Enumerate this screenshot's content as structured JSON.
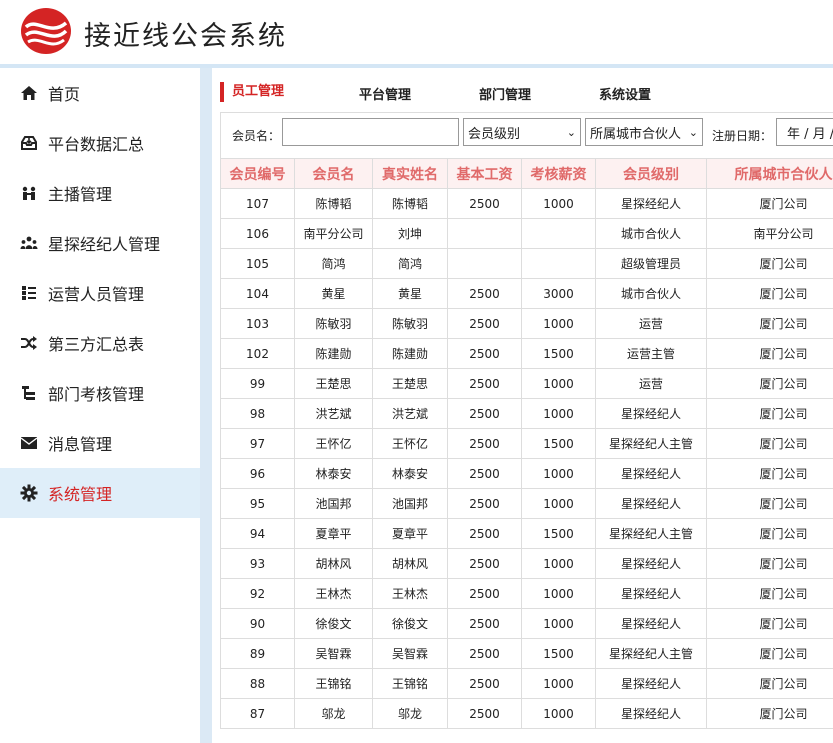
{
  "app": {
    "title": "接近线公会系统",
    "logo": "swirl-logo"
  },
  "colors": {
    "accent": "#d42424",
    "sidebar_active_bg": "#dfeef9",
    "header_line": "#d4e6f5",
    "table_header_bg": "#fdf1f1",
    "table_header_text": "#e06a6a"
  },
  "sidebar": {
    "items": [
      {
        "label": "首页",
        "icon": "home-icon",
        "active": false
      },
      {
        "label": "平台数据汇总",
        "icon": "inbox-icon",
        "active": false
      },
      {
        "label": "主播管理",
        "icon": "users-icon",
        "active": false
      },
      {
        "label": "星探经纪人管理",
        "icon": "group-icon",
        "active": false
      },
      {
        "label": "运营人员管理",
        "icon": "list-icon",
        "active": false
      },
      {
        "label": "第三方汇总表",
        "icon": "shuffle-icon",
        "active": false
      },
      {
        "label": "部门考核管理",
        "icon": "sitemap-icon",
        "active": false
      },
      {
        "label": "消息管理",
        "icon": "mail-icon",
        "active": false
      },
      {
        "label": "系统管理",
        "icon": "gear-icon",
        "active": true
      }
    ]
  },
  "tabs": [
    {
      "label": "员工管理",
      "active": true
    },
    {
      "label": "平台管理",
      "active": false
    },
    {
      "label": "部门管理",
      "active": false
    },
    {
      "label": "系统设置",
      "active": false
    }
  ],
  "filters": {
    "member_name_label": "会员名：",
    "member_name_value": "",
    "level_select": "会员级别",
    "city_select": "所属城市合伙人",
    "reg_date_label": "注册日期：",
    "reg_date_value": "年 / 月 / 日"
  },
  "table": {
    "headers": [
      "会员编号",
      "会员名",
      "真实姓名",
      "基本工资",
      "考核薪资",
      "会员级别",
      "所属城市合伙人"
    ],
    "rows": [
      [
        "107",
        "陈博韬",
        "陈博韬",
        "2500",
        "1000",
        "星探经纪人",
        "厦门公司"
      ],
      [
        "106",
        "南平分公司",
        "刘坤",
        "",
        "",
        "城市合伙人",
        "南平分公司"
      ],
      [
        "105",
        "简鸿",
        "简鸿",
        "",
        "",
        "超级管理员",
        "厦门公司"
      ],
      [
        "104",
        "黄星",
        "黄星",
        "2500",
        "3000",
        "城市合伙人",
        "厦门公司"
      ],
      [
        "103",
        "陈敏羽",
        "陈敏羽",
        "2500",
        "1000",
        "运营",
        "厦门公司"
      ],
      [
        "102",
        "陈建勋",
        "陈建勋",
        "2500",
        "1500",
        "运营主管",
        "厦门公司"
      ],
      [
        "99",
        "王楚思",
        "王楚思",
        "2500",
        "1000",
        "运营",
        "厦门公司"
      ],
      [
        "98",
        "洪艺斌",
        "洪艺斌",
        "2500",
        "1000",
        "星探经纪人",
        "厦门公司"
      ],
      [
        "97",
        "王怀亿",
        "王怀亿",
        "2500",
        "1500",
        "星探经纪人主管",
        "厦门公司"
      ],
      [
        "96",
        "林泰安",
        "林泰安",
        "2500",
        "1000",
        "星探经纪人",
        "厦门公司"
      ],
      [
        "95",
        "池国邦",
        "池国邦",
        "2500",
        "1000",
        "星探经纪人",
        "厦门公司"
      ],
      [
        "94",
        "夏章平",
        "夏章平",
        "2500",
        "1500",
        "星探经纪人主管",
        "厦门公司"
      ],
      [
        "93",
        "胡林风",
        "胡林风",
        "2500",
        "1000",
        "星探经纪人",
        "厦门公司"
      ],
      [
        "92",
        "王林杰",
        "王林杰",
        "2500",
        "1000",
        "星探经纪人",
        "厦门公司"
      ],
      [
        "90",
        "徐俊文",
        "徐俊文",
        "2500",
        "1000",
        "星探经纪人",
        "厦门公司"
      ],
      [
        "89",
        "吴智霖",
        "吴智霖",
        "2500",
        "1500",
        "星探经纪人主管",
        "厦门公司"
      ],
      [
        "88",
        "王锦铭",
        "王锦铭",
        "2500",
        "1000",
        "星探经纪人",
        "厦门公司"
      ],
      [
        "87",
        "邬龙",
        "邬龙",
        "2500",
        "1000",
        "星探经纪人",
        "厦门公司"
      ]
    ]
  }
}
